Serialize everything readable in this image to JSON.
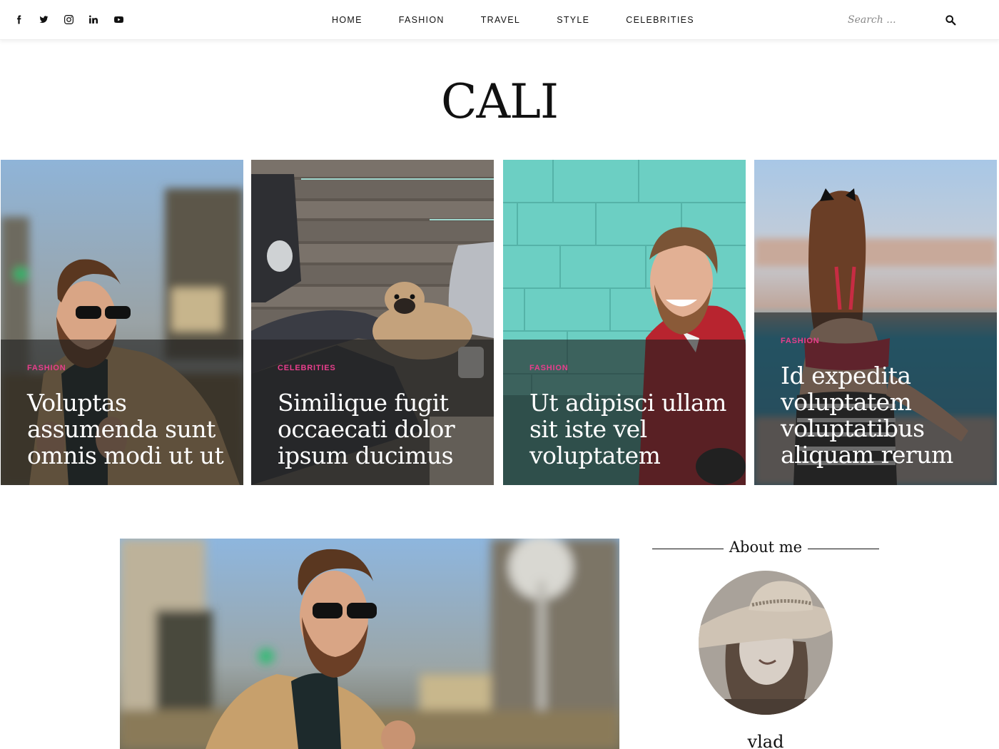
{
  "social": {
    "icons": [
      "facebook-icon",
      "twitter-icon",
      "instagram-icon",
      "linkedin-icon",
      "youtube-icon"
    ]
  },
  "nav": {
    "items": [
      "HOME",
      "FASHION",
      "TRAVEL",
      "STYLE",
      "CELEBRITIES"
    ]
  },
  "search": {
    "placeholder": "Search ...",
    "icon": "search-icon"
  },
  "site": {
    "logo": "CALI"
  },
  "featured": [
    {
      "category": "FASHION",
      "title": "Voluptas assumenda sunt omnis modi ut ut"
    },
    {
      "category": "CELEBRITIES",
      "title": "Similique fugit occaecati dolor ipsum ducimus"
    },
    {
      "category": "FASHION",
      "title": "Ut adipisci ullam sit iste vel voluptatem"
    },
    {
      "category": "FASHION",
      "title": "Id expedita voluptatem voluptatibus aliquam rerum"
    }
  ],
  "sidebar": {
    "about_title": "About me",
    "name": "vlad"
  },
  "colors": {
    "accent": "#e83e8c",
    "text": "#111111",
    "overlay": "#1e1e1e"
  }
}
